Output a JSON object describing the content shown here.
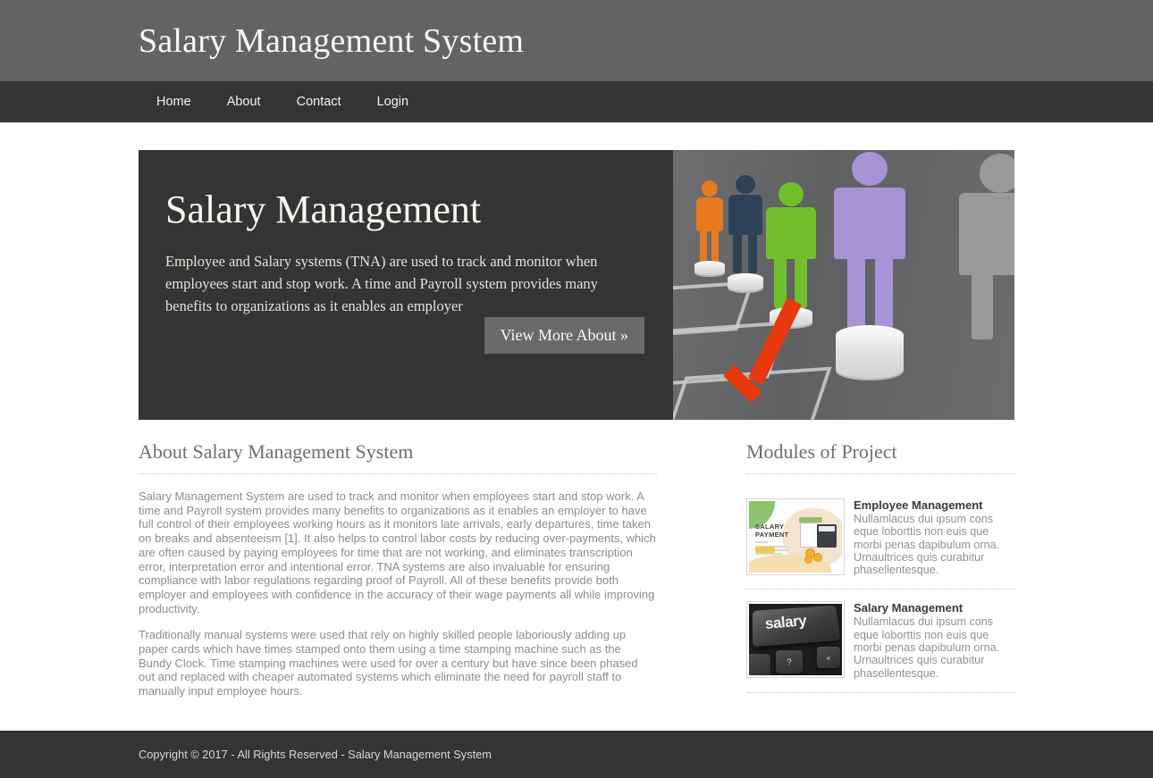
{
  "header": {
    "site_title": "Salary Management System"
  },
  "nav": {
    "items": [
      {
        "label": "Home",
        "name": "nav-item-home"
      },
      {
        "label": "About",
        "name": "nav-item-about"
      },
      {
        "label": "Contact",
        "name": "nav-item-contact"
      },
      {
        "label": "Login",
        "name": "nav-item-login"
      }
    ]
  },
  "hero": {
    "title": "Salary Management",
    "description": "Employee and Salary systems (TNA) are used to track and monitor when employees start and stop work. A time and Payroll system provides many benefits to organizations as it enables an employer",
    "button_label": "View More About »",
    "image": {
      "alt": "people-on-coin-stacks-illustration",
      "figure_colors": [
        "#e8791e",
        "#2e4257",
        "#72bf2e",
        "#a893d6",
        "#9a9a9a"
      ],
      "checkmark_color": "#e8380d",
      "background_color": "#67686a"
    }
  },
  "about": {
    "heading": "About Salary Management System",
    "paragraphs": [
      "Salary Management System are used to track and monitor when employees start and stop work. A time and Payroll system provides many benefits to organizations as it enables an employer to have full control of their employees working hours as it monitors late arrivals, early departures, time taken on breaks and absenteeism [1]. It also helps to control labor costs by reducing over-payments, which are often caused by paying employees for time that are not working, and eliminates transcription error, interpretation error and intentional error. TNA systems are also invaluable for ensuring compliance with labor regulations regarding proof of Payroll. All of these benefits provide both employer and employees with confidence in the accuracy of their wage payments all while improving productivity.",
      "Traditionally manual systems were used that rely on highly skilled people laboriously adding up paper cards which have times stamped onto them using a time stamping machine such as the Bundy Clock. Time stamping machines were used for over a century but have since been phased out and replaced with cheaper automated systems which eliminate the need for payroll staff to manually input employee hours."
    ]
  },
  "modules": {
    "heading": "Modules of Project",
    "items": [
      {
        "title": "Employee Management",
        "description": "Nullamlacus dui ipsum cons eque loborttis non euis que morbi penas dapibulum orna. Urnaultrices quis curabitur phasellentesque.",
        "thumb_alt": "salary-payment-illustration",
        "thumb_text_line1": "SALARY",
        "thumb_text_line2": "PAYMENT"
      },
      {
        "title": "Salary Management",
        "description": "Nullamlacus dui ipsum cons eque loborttis non euis que morbi penas dapibulum orna. Urnaultrices quis curabitur phasellentesque.",
        "thumb_alt": "salary-keyboard-key-photo",
        "thumb_key_label": "salary",
        "thumb_key_small_1": "?",
        "thumb_key_small_2": "«"
      }
    ]
  },
  "footer": {
    "copyright": "Copyright © 2017 - All Rights Reserved - Salary Management System"
  },
  "theme": {
    "header_bg": "#626365",
    "nav_bg": "#343434",
    "hero_bg": "#343434",
    "footer_bg": "#343434",
    "button_bg": "#6a6a6a",
    "body_text": "#8a8e92",
    "heading_text": "#6b6f75"
  }
}
